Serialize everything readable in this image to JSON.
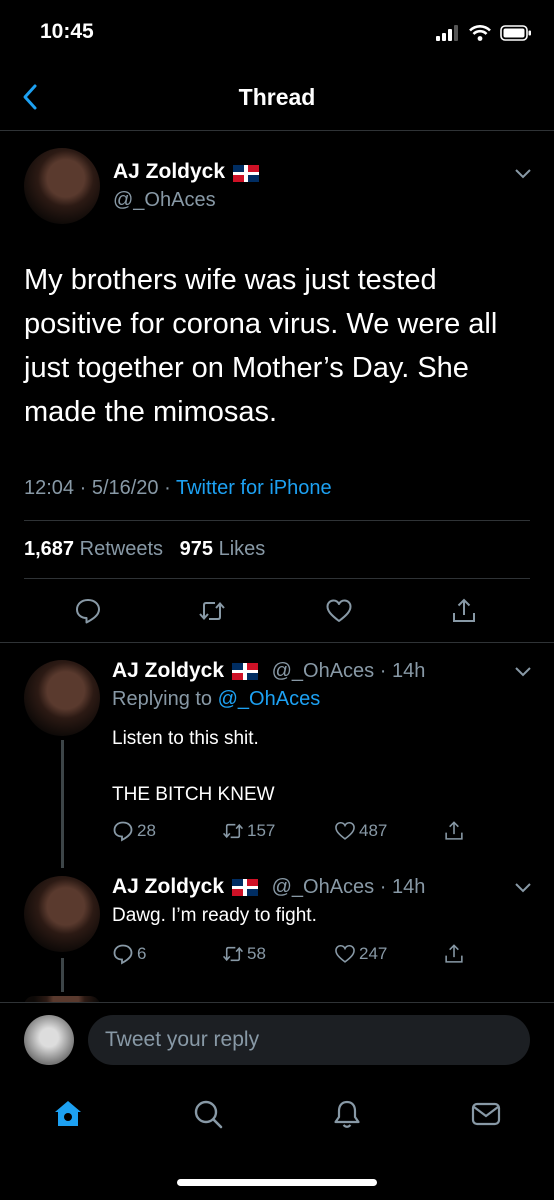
{
  "status_bar": {
    "time": "10:45"
  },
  "header": {
    "title": "Thread"
  },
  "main_tweet": {
    "name": "AJ Zoldyck",
    "handle": "@_OhAces",
    "text": "My brothers wife was just tested positive for corona virus. We were all just together on Mother’s Day. She made the mimosas.",
    "time": "12:04 · 5/16/20 · ",
    "source": "Twitter for iPhone",
    "retweets_count": "1,687",
    "retweets_label": "Retweets",
    "likes_count": "975",
    "likes_label": "Likes"
  },
  "replies": [
    {
      "name": "AJ Zoldyck",
      "handle": "@_OhAces",
      "age": "· 14h",
      "replying_prefix": "Replying to ",
      "replying_to": "@_OhAces",
      "text_lines": [
        "Listen to this shit.",
        "THE BITCH KNEW"
      ],
      "replies": "28",
      "retweets": "157",
      "likes": "487"
    },
    {
      "name": "AJ Zoldyck",
      "handle": "@_OhAces",
      "age": "· 14h",
      "text_lines": [
        "Dawg. I’m ready to fight."
      ],
      "replies": "6",
      "retweets": "58",
      "likes": "247"
    }
  ],
  "compose": {
    "placeholder": "Tweet your reply"
  },
  "colors": {
    "accent": "#1da1f2",
    "muted": "#8899a6",
    "background": "#000000"
  }
}
